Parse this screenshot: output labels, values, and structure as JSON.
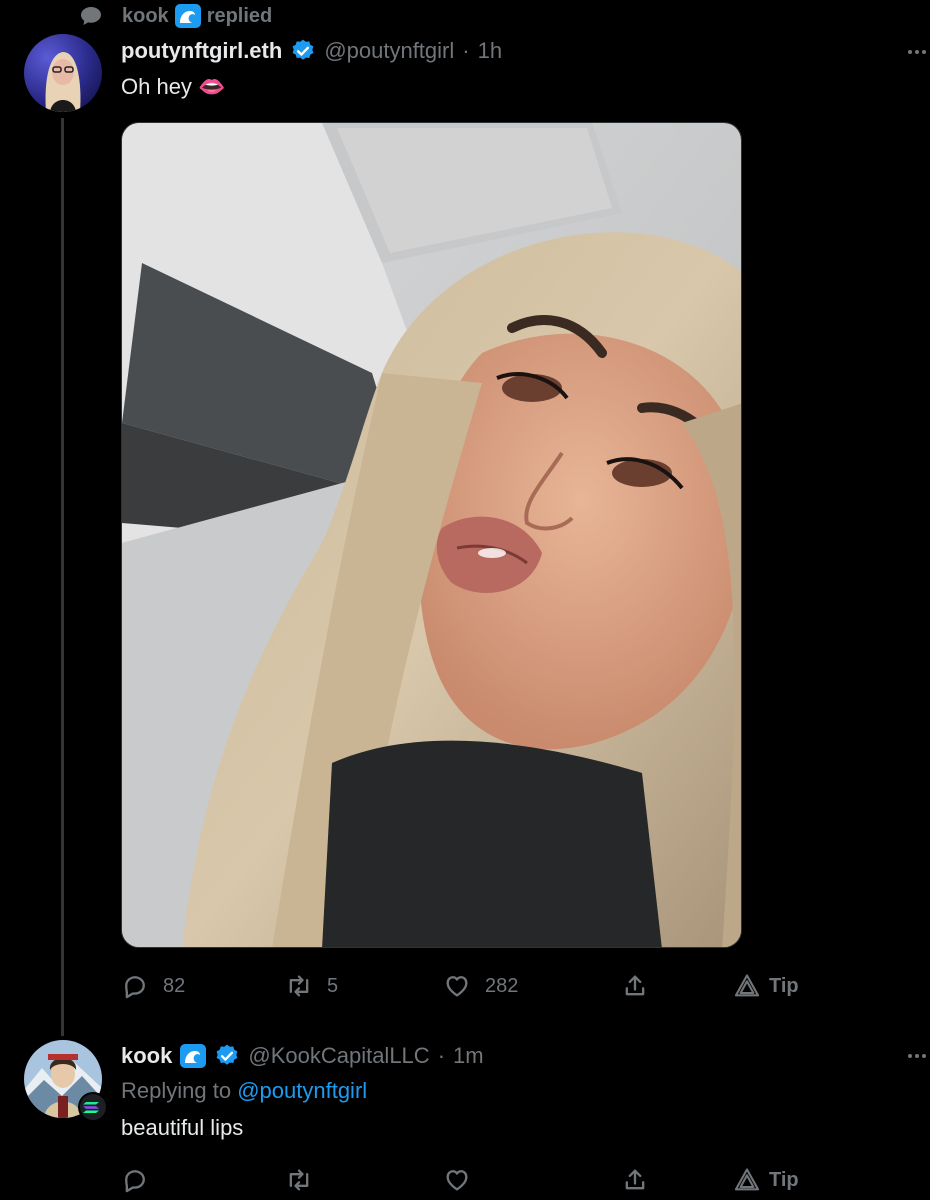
{
  "context": {
    "user": "kook",
    "action": "replied"
  },
  "tweet": {
    "display_name": "poutynftgirl.eth",
    "handle": "@poutynftgirl",
    "separator": "·",
    "time": "1h",
    "text": "Oh hey 👄",
    "stats": {
      "replies": "82",
      "retweets": "5",
      "likes": "282",
      "tip": "Tip"
    }
  },
  "reply": {
    "display_name": "kook",
    "handle": "@KookCapitalLLC",
    "separator": "·",
    "time": "1m",
    "replying_prefix": "Replying to",
    "replying_to": "@poutynftgirl",
    "text": "beautiful lips",
    "tip": "Tip"
  },
  "colors": {
    "background": "#000000",
    "text": "#e7e9ea",
    "muted": "#71767b",
    "link": "#1d9bf0",
    "verified": "#1d9bf0",
    "thread_line": "#333639"
  },
  "icons": [
    "comment-icon",
    "verified-icon",
    "wave-icon",
    "more-icon",
    "reply-icon",
    "retweet-icon",
    "like-icon",
    "share-icon",
    "tip-icon",
    "solana-icon"
  ]
}
